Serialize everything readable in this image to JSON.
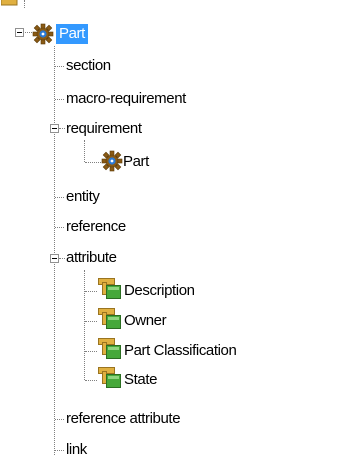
{
  "tree": {
    "root": {
      "label": "Part",
      "icon": "gear-icon",
      "selected": true
    },
    "items": [
      {
        "label": "section"
      },
      {
        "label": "macro-requirement"
      },
      {
        "label": "requirement",
        "children": [
          {
            "label": "Part",
            "icon": "gear-icon"
          }
        ]
      },
      {
        "label": "entity"
      },
      {
        "label": "reference"
      },
      {
        "label": "attribute",
        "children": [
          {
            "label": "Description",
            "icon": "attribute-icon"
          },
          {
            "label": "Owner",
            "icon": "attribute-icon"
          },
          {
            "label": "Part Classification",
            "icon": "attribute-icon"
          },
          {
            "label": "State",
            "icon": "attribute-icon"
          }
        ]
      },
      {
        "label": "reference attribute"
      },
      {
        "label": "link"
      }
    ]
  },
  "colors": {
    "selection": "#3399ff",
    "tree_line": "#808080",
    "gear": "#8a5a14",
    "gear_center": "#2a7ad6",
    "folder": "#e0b040",
    "attribute_green": "#46a83a"
  }
}
